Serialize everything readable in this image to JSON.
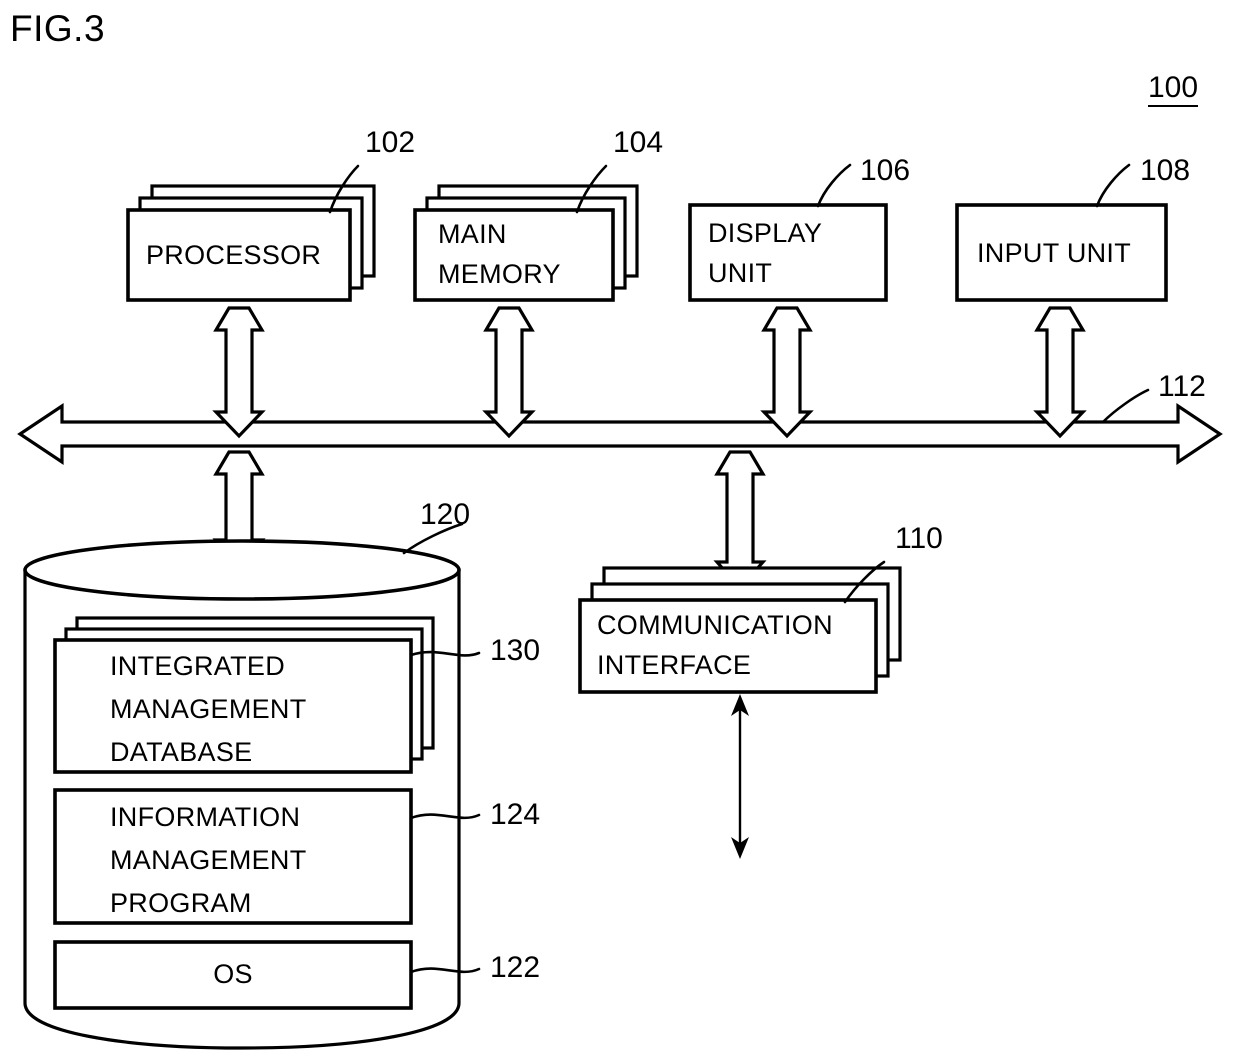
{
  "figure": {
    "title": "FIG.3",
    "system_ref": "100"
  },
  "components": {
    "processor": {
      "label": "PROCESSOR",
      "ref": "102",
      "stacked": true
    },
    "main_memory": {
      "label_line1": "MAIN",
      "label_line2": "MEMORY",
      "ref": "104",
      "stacked": true
    },
    "display_unit": {
      "label_line1": "DISPLAY",
      "label_line2": "UNIT",
      "ref": "106",
      "stacked": false
    },
    "input_unit": {
      "label": "INPUT UNIT",
      "ref": "108",
      "stacked": false
    },
    "communication_interface": {
      "label_line1": "COMMUNICATION",
      "label_line2": "INTERFACE",
      "ref": "110",
      "stacked": true
    },
    "bus": {
      "ref": "112"
    },
    "storage": {
      "ref": "120"
    },
    "integrated_management_database": {
      "label_line1": "INTEGRATED",
      "label_line2": "MANAGEMENT",
      "label_line3": "DATABASE",
      "ref": "130",
      "stacked": true
    },
    "information_management_program": {
      "label_line1": "INFORMATION",
      "label_line2": "MANAGEMENT",
      "label_line3": "PROGRAM",
      "ref": "124",
      "stacked": false
    },
    "os": {
      "label": "OS",
      "ref": "122",
      "stacked": false
    }
  },
  "style": {
    "line_color": "#000000",
    "fill_color": "#ffffff"
  }
}
